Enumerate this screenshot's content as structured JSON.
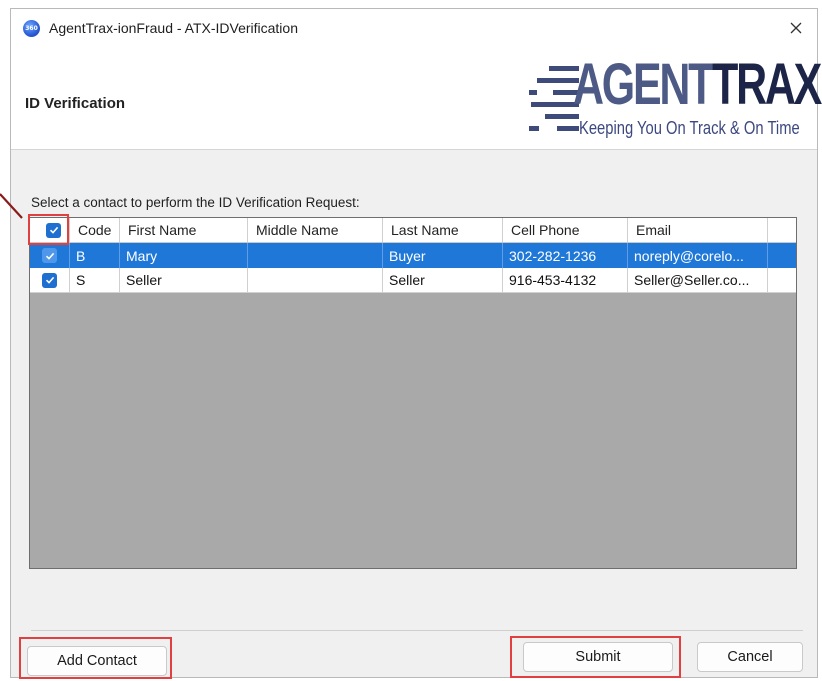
{
  "window": {
    "title": "AgentTrax-ionFraud - ATX-IDVerification",
    "app_icon_text": "360"
  },
  "header": {
    "page_title": "ID Verification",
    "logo": {
      "word_agent": "AGENT",
      "word_trax": "TRAX",
      "tagline": "Keeping You On Track & On Time"
    }
  },
  "instruction": "Select a contact to perform the ID Verification Request:",
  "grid": {
    "columns": [
      "",
      "Code",
      "First Name",
      "Middle Name",
      "Last Name",
      "Cell Phone",
      "Email"
    ],
    "rows": [
      {
        "checked": true,
        "code": "B",
        "first_name": "Mary",
        "middle_name": "",
        "last_name": "Buyer",
        "cell_phone": "302-282-1236",
        "email": "noreply@corelo...",
        "selected": true
      },
      {
        "checked": true,
        "code": "S",
        "first_name": "Seller",
        "middle_name": "",
        "last_name": "Seller",
        "cell_phone": "916-453-4132",
        "email": "Seller@Seller.co...",
        "selected": false
      }
    ]
  },
  "buttons": {
    "add_contact": "Add Contact",
    "submit": "Submit",
    "cancel": "Cancel"
  },
  "colors": {
    "selection": "#1f78d8",
    "checkbox": "#1e6fd0",
    "annotation": "#e04040",
    "grid_background": "#a9a9a9"
  }
}
